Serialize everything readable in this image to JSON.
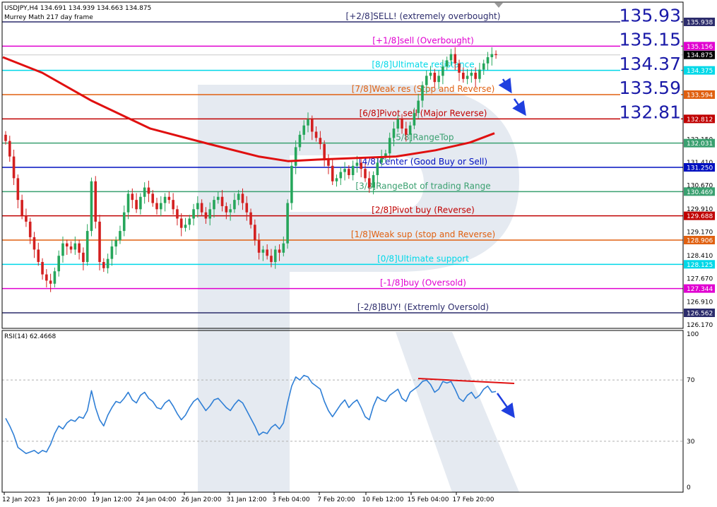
{
  "header": {
    "symbol_line": "USDJPY,H4  134.691 134.939 134.663 134.875",
    "indicator_line": "Murrey Math 217 day frame"
  },
  "rsi_label": "RSI(14) 62.4668",
  "colors": {
    "bull": "#26a65b",
    "bear": "#d32020",
    "ma": "#e01010",
    "rsi": "#2f7fd6",
    "arrow": "#1f3fdf",
    "trend": "#e01010",
    "watermark": "#dfe5ee"
  },
  "chart_data": [
    {
      "type": "candlestick",
      "symbol": "USDJPY",
      "timeframe": "H4",
      "ohlc_last": {
        "open": 134.691,
        "high": 134.939,
        "low": 134.663,
        "close": 134.875
      },
      "ylim": [
        126.17,
        135.93
      ],
      "y_ticks": [
        "132.150",
        "131.410",
        "130.670",
        "129.910",
        "129.170",
        "128.410",
        "127.670",
        "126.910",
        "126.170"
      ],
      "x_ticks": [
        "12 Jan 2023",
        "16 Jan 20:00",
        "19 Jan 12:00",
        "24 Jan 04:00",
        "26 Jan 20:00",
        "31 Jan 12:00",
        "3 Feb 04:00",
        "7 Feb 20:00",
        "10 Feb 12:00",
        "15 Feb 04:00",
        "17 Feb 20:00"
      ],
      "levels": [
        {
          "label": "[+2/8]SELL! (extremely overbought)",
          "value": 135.938,
          "tag": "135.938",
          "color": "#2c2c6c"
        },
        {
          "label": "[+1/8]sell (Overbought)",
          "value": 135.156,
          "tag": "135.156",
          "color": "#e000d0"
        },
        {
          "label": "[8/8]Ultimate resistance",
          "value": 134.375,
          "tag": "134.375",
          "color": "#00d8e8"
        },
        {
          "label": "[7/8]Weak res (Stop and Reverse)",
          "value": 133.594,
          "tag": "133.594",
          "color": "#e06010"
        },
        {
          "label": "[6/8]Pivot sell (Major Reverse)",
          "value": 132.812,
          "tag": "132.812",
          "color": "#c00000"
        },
        {
          "label": "[5/8]RangeTop",
          "value": 132.031,
          "tag": "132.031",
          "color": "#3aa070"
        },
        {
          "label": "[4/8]Center (Good Buy or Sell)",
          "value": 131.25,
          "tag": "131.250",
          "color": "#0010c0"
        },
        {
          "label": "[3/8]RangeBot of trading Range",
          "value": 130.469,
          "tag": "130.469",
          "color": "#3aa070"
        },
        {
          "label": "[2/8]Pivot buy (Reverse)",
          "value": 129.688,
          "tag": "129.688",
          "color": "#c00000"
        },
        {
          "label": "[1/8]Weak sup (stop and Reverse)",
          "value": 128.906,
          "tag": "128.906",
          "color": "#e06010"
        },
        {
          "label": "[0/8]Ultimate support",
          "value": 128.125,
          "tag": "128.125",
          "color": "#00d8e8"
        },
        {
          "label": "[-1/8]buy (Oversold)",
          "value": 127.344,
          "tag": "127.344",
          "color": "#e000d0"
        },
        {
          "label": "[-2/8]BUY! (Extremly Oversold)",
          "value": 126.562,
          "tag": "126.562",
          "color": "#2c2c6c"
        }
      ],
      "big_labels": [
        "135.93",
        "135.15",
        "134.37",
        "133.59",
        "132.81"
      ],
      "close_tag": "134.875",
      "close_path": [
        132.1,
        131.6,
        130.9,
        130.2,
        129.7,
        129.5,
        129.0,
        128.6,
        128.2,
        127.8,
        127.6,
        127.5,
        127.9,
        128.4,
        128.8,
        128.7,
        128.6,
        128.8,
        128.5,
        128.2,
        129.2,
        130.8,
        129.5,
        128.2,
        128.0,
        128.3,
        128.7,
        128.9,
        129.2,
        129.8,
        130.4,
        130.2,
        129.9,
        130.3,
        130.6,
        130.4,
        130.1,
        129.9,
        130.1,
        130.3,
        130.2,
        129.9,
        129.6,
        129.3,
        129.4,
        129.6,
        129.9,
        130.1,
        129.8,
        129.6,
        129.9,
        130.2,
        130.3,
        130.0,
        129.8,
        129.9,
        130.2,
        130.4,
        130.1,
        129.8,
        129.4,
        128.9,
        128.5,
        128.6,
        128.4,
        128.2,
        128.6,
        128.5,
        128.8,
        130.1,
        131.3,
        131.9,
        132.3,
        132.6,
        132.8,
        132.4,
        132.2,
        132.0,
        131.5,
        131.3,
        130.8,
        130.9,
        131.1,
        131.2,
        131.0,
        131.3,
        131.4,
        131.2,
        130.9,
        130.6,
        131.0,
        131.4,
        131.6,
        131.7,
        132.2,
        132.5,
        132.8,
        132.5,
        132.3,
        132.6,
        133.0,
        133.4,
        133.9,
        134.2,
        134.3,
        134.0,
        134.2,
        134.5,
        134.7,
        134.9,
        134.6,
        134.3,
        134.1,
        134.2,
        134.3,
        134.1,
        134.4,
        134.6,
        134.8,
        134.9,
        134.87
      ],
      "ma_path": [
        [
          0,
          134.8
        ],
        [
          0.08,
          134.3
        ],
        [
          0.18,
          133.4
        ],
        [
          0.3,
          132.5
        ],
        [
          0.42,
          132.0
        ],
        [
          0.52,
          131.6
        ],
        [
          0.58,
          131.45
        ],
        [
          0.64,
          131.5
        ],
        [
          0.72,
          131.55
        ],
        [
          0.8,
          131.6
        ],
        [
          0.88,
          131.8
        ],
        [
          0.95,
          132.05
        ],
        [
          1,
          132.35
        ]
      ]
    },
    {
      "type": "line",
      "name": "RSI(14)",
      "ylim": [
        0,
        100
      ],
      "y_ticks": [
        "100",
        "70",
        "30",
        "0"
      ],
      "levels": [
        70,
        30
      ],
      "values": [
        45,
        40,
        34,
        26,
        24,
        22,
        23,
        24,
        22,
        24,
        23,
        28,
        35,
        40,
        38,
        42,
        44,
        43,
        46,
        45,
        50,
        63,
        52,
        44,
        40,
        47,
        52,
        56,
        55,
        58,
        62,
        57,
        55,
        60,
        62,
        58,
        56,
        52,
        51,
        55,
        57,
        53,
        48,
        44,
        47,
        52,
        56,
        58,
        54,
        50,
        53,
        57,
        58,
        55,
        52,
        50,
        54,
        57,
        55,
        50,
        45,
        40,
        34,
        36,
        35,
        39,
        41,
        38,
        42,
        55,
        66,
        72,
        70,
        73,
        72,
        68,
        66,
        64,
        56,
        50,
        46,
        50,
        54,
        57,
        52,
        55,
        57,
        52,
        46,
        44,
        53,
        59,
        57,
        56,
        60,
        62,
        64,
        58,
        56,
        62,
        64,
        66,
        69,
        70,
        67,
        62,
        64,
        69,
        68,
        69,
        64,
        58,
        56,
        60,
        62,
        58,
        60,
        64,
        66,
        62,
        62.4668
      ]
    }
  ]
}
